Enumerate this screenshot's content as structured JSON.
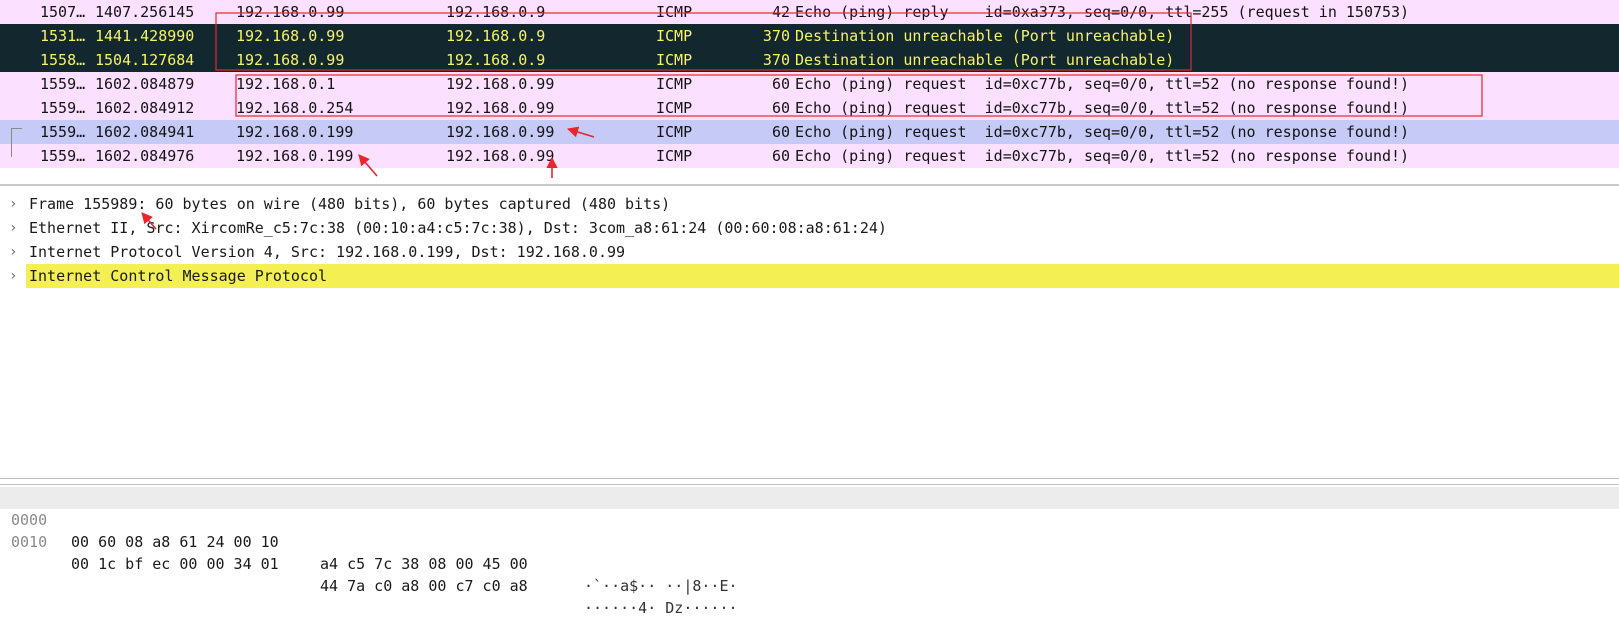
{
  "packet_list": {
    "rows": [
      {
        "no": "1507…",
        "time": "1407.256145",
        "src": "192.168.0.99",
        "dst": "192.168.0.9",
        "proto": "ICMP",
        "len": "42",
        "info": "Echo (ping) reply    id=0xa373, seq=0/0, ttl=255 (request in 150753)",
        "style": "pink"
      },
      {
        "no": "1531…",
        "time": "1441.428990",
        "src": "192.168.0.99",
        "dst": "192.168.0.9",
        "proto": "ICMP",
        "len": "370",
        "info": "Destination unreachable (Port unreachable)",
        "style": "dark"
      },
      {
        "no": "1558…",
        "time": "1504.127684",
        "src": "192.168.0.99",
        "dst": "192.168.0.9",
        "proto": "ICMP",
        "len": "370",
        "info": "Destination unreachable (Port unreachable)",
        "style": "dark"
      },
      {
        "no": "1559…",
        "time": "1602.084879",
        "src": "192.168.0.1",
        "dst": "192.168.0.99",
        "proto": "ICMP",
        "len": "60",
        "info": "Echo (ping) request  id=0xc77b, seq=0/0, ttl=52 (no response found!)",
        "style": "pink"
      },
      {
        "no": "1559…",
        "time": "1602.084912",
        "src": "192.168.0.254",
        "dst": "192.168.0.99",
        "proto": "ICMP",
        "len": "60",
        "info": "Echo (ping) request  id=0xc77b, seq=0/0, ttl=52 (no response found!)",
        "style": "pink"
      },
      {
        "no": "1559…",
        "time": "1602.084941",
        "src": "192.168.0.199",
        "dst": "192.168.0.99",
        "proto": "ICMP",
        "len": "60",
        "info": "Echo (ping) request  id=0xc77b, seq=0/0, ttl=52 (no response found!)",
        "style": "selected"
      },
      {
        "no": "1559…",
        "time": "1602.084976",
        "src": "192.168.0.199",
        "dst": "192.168.0.99",
        "proto": "ICMP",
        "len": "60",
        "info": "Echo (ping) request  id=0xc77b, seq=0/0, ttl=52 (no response found!)",
        "style": "pink"
      }
    ]
  },
  "details": {
    "items": [
      {
        "label": "Frame 155989: 60 bytes on wire (480 bits), 60 bytes captured (480 bits)",
        "icon": "chevron-right-icon"
      },
      {
        "label": "Ethernet II, Src: XircomRe_c5:7c:38 (00:10:a4:c5:7c:38), Dst: 3com_a8:61:24 (00:60:08:a8:61:24)",
        "icon": "chevron-right-icon"
      },
      {
        "label": "Internet Protocol Version 4, Src: 192.168.0.199, Dst: 192.168.0.99",
        "icon": "chevron-right-icon"
      },
      {
        "label": "Internet Control Message Protocol",
        "icon": "chevron-right-icon",
        "highlight": true
      }
    ]
  },
  "hex": {
    "rows": [
      {
        "offset": "0000",
        "bytes1": "00 60 08 a8 61 24 00 10",
        "bytes2": "a4 c5 7c 38 08 00 45 00",
        "ascii": "·`··a$·· ··|8··E·"
      },
      {
        "offset": "0010",
        "bytes1": "00 1c bf ec 00 00 34 01",
        "bytes2": "44 7a c0 a8 00 c7 c0 a8",
        "ascii": "······4· Dz······"
      }
    ]
  },
  "colors": {
    "row_pink": "#fce0ff",
    "row_dark": "#12272e",
    "row_dark_text": "#f7f26a",
    "row_selected": "#c6caf7",
    "highlight_yellow": "#f4ef52",
    "annotation_red": "#e8262b"
  }
}
